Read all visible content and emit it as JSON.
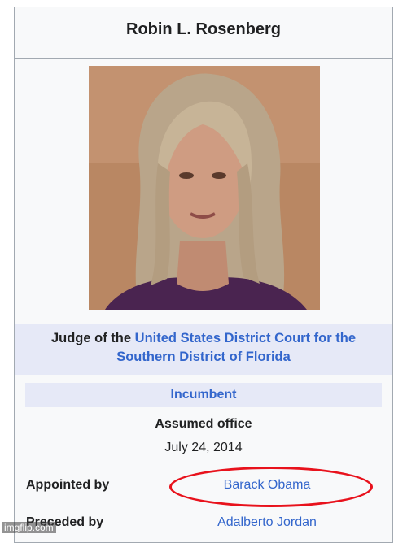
{
  "infobox": {
    "title": "Robin L. Rosenberg",
    "position": {
      "prefix": "Judge of the",
      "court_link_line1": "United States District Court for the",
      "court_link_line2": "Southern District of Florida"
    },
    "status": "Incumbent",
    "assumed_office_label": "Assumed office",
    "assumed_office_date": "July 24, 2014",
    "appointed_by_label": "Appointed by",
    "appointed_by_value": "Barack Obama",
    "preceded_by_label": "Preceded by",
    "preceded_by_value": "Adalberto Jordan"
  },
  "watermark": "imgflip.com",
  "colors": {
    "link": "#3366cc",
    "header_bg": "#e6e9f7",
    "highlight_circle": "#e8121c"
  }
}
